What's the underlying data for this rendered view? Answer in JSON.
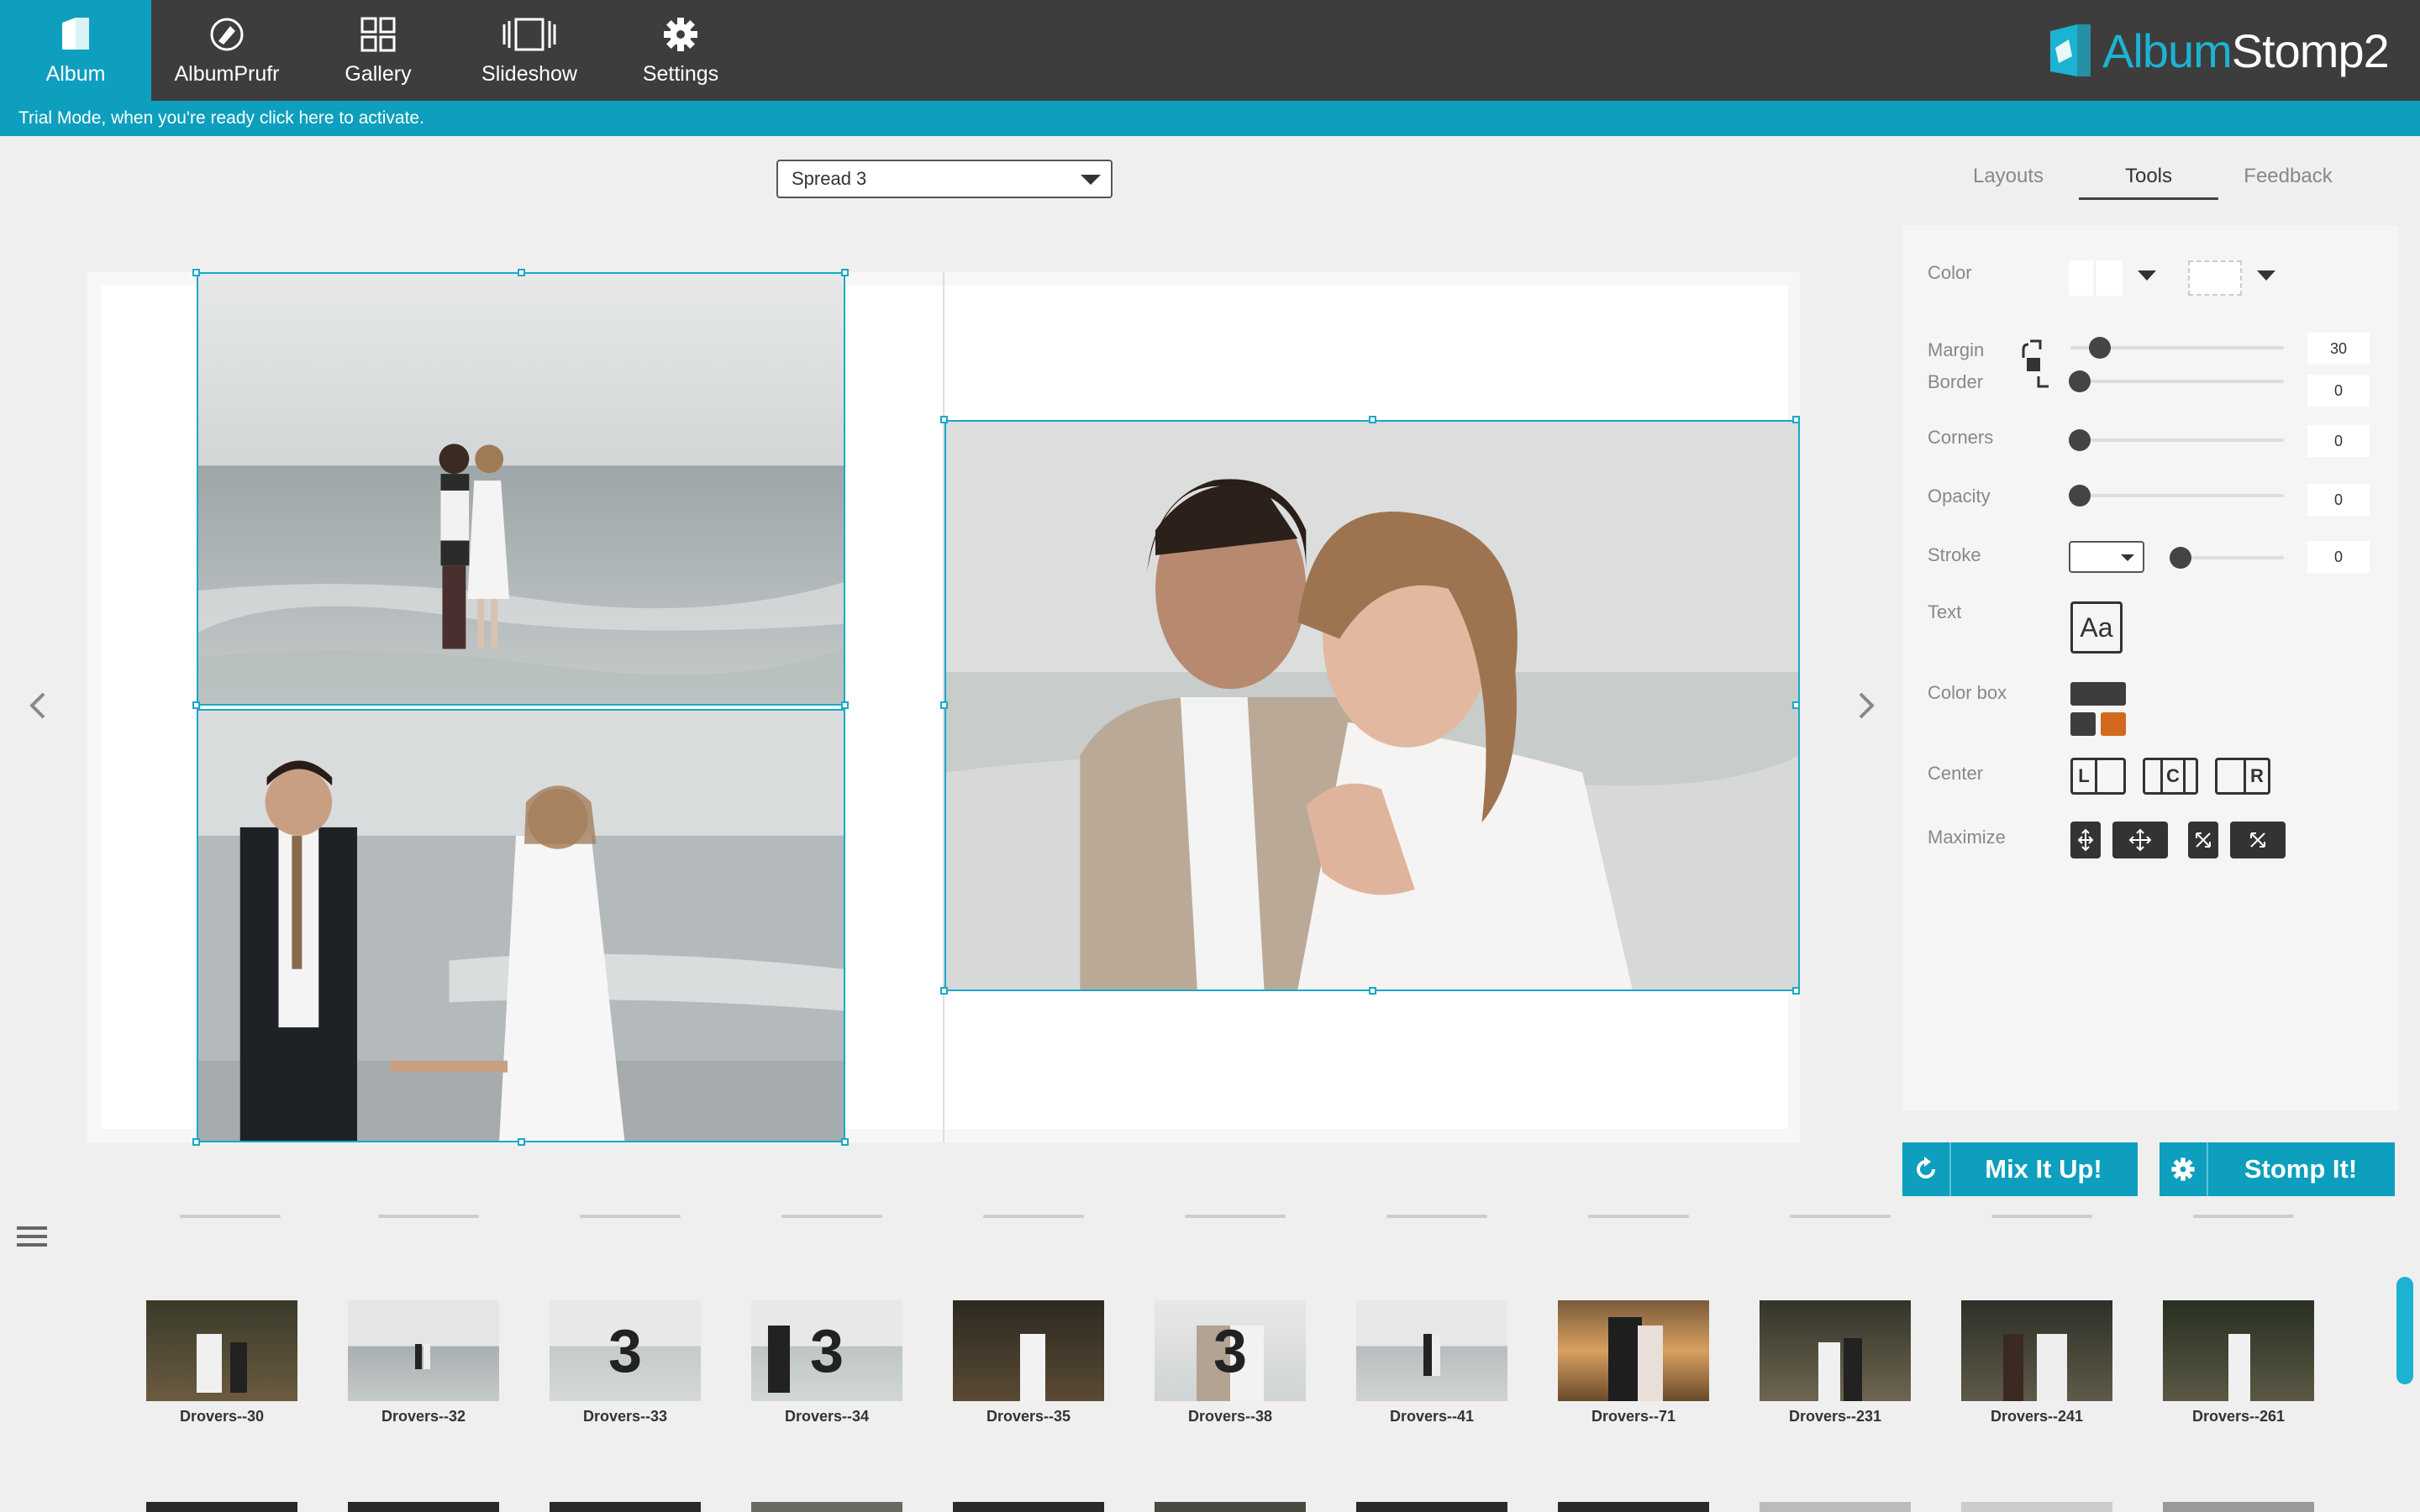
{
  "nav": {
    "items": [
      {
        "label": "Album",
        "icon": "album-icon",
        "active": true
      },
      {
        "label": "AlbumPrufr",
        "icon": "albumprufr-icon",
        "active": false
      },
      {
        "label": "Gallery",
        "icon": "gallery-grid-icon",
        "active": false
      },
      {
        "label": "Slideshow",
        "icon": "slideshow-icon",
        "active": false
      },
      {
        "label": "Settings",
        "icon": "gear-icon",
        "active": false
      }
    ],
    "logo_text_1": "Album",
    "logo_text_2": "Stomp2"
  },
  "trial_text": "Trial Mode, when you're ready click here to activate.",
  "spread_select": {
    "value": "Spread 3"
  },
  "panel_tabs": [
    {
      "label": "Layouts",
      "active": false
    },
    {
      "label": "Tools",
      "active": true
    },
    {
      "label": "Feedback",
      "active": false
    }
  ],
  "tools": {
    "color_label": "Color",
    "margin_label": "Margin",
    "border_label": "Border",
    "corners_label": "Corners",
    "opacity_label": "Opacity",
    "stroke_label": "Stroke",
    "text_label": "Text",
    "text_button": "Aa",
    "colorbox_label": "Color box",
    "center_label": "Center",
    "maximize_label": "Maximize",
    "margin_value": "30",
    "border_value": "0",
    "corners_value": "0",
    "opacity_value": "0",
    "stroke_value": "0",
    "center_buttons": [
      "L",
      "C",
      "R"
    ],
    "colorbox_colors": [
      "#3d3d3d",
      "#3d3d3d",
      "#d2691e"
    ]
  },
  "buttons": {
    "mix": "Mix It Up!",
    "stomp": "Stomp It!"
  },
  "thumbnails": [
    {
      "caption": "Drovers--30",
      "badge": ""
    },
    {
      "caption": "Drovers--32",
      "badge": ""
    },
    {
      "caption": "Drovers--33",
      "badge": "3"
    },
    {
      "caption": "Drovers--34",
      "badge": "3"
    },
    {
      "caption": "Drovers--35",
      "badge": ""
    },
    {
      "caption": "Drovers--38",
      "badge": "3"
    },
    {
      "caption": "Drovers--41",
      "badge": ""
    },
    {
      "caption": "Drovers--71",
      "badge": ""
    },
    {
      "caption": "Drovers--231",
      "badge": ""
    },
    {
      "caption": "Drovers--241",
      "badge": ""
    },
    {
      "caption": "Drovers--261",
      "badge": ""
    }
  ],
  "colors": {
    "accent": "#0d9fbd",
    "topbar": "#3d3d3d",
    "frame_border": "#1aa8c8"
  }
}
